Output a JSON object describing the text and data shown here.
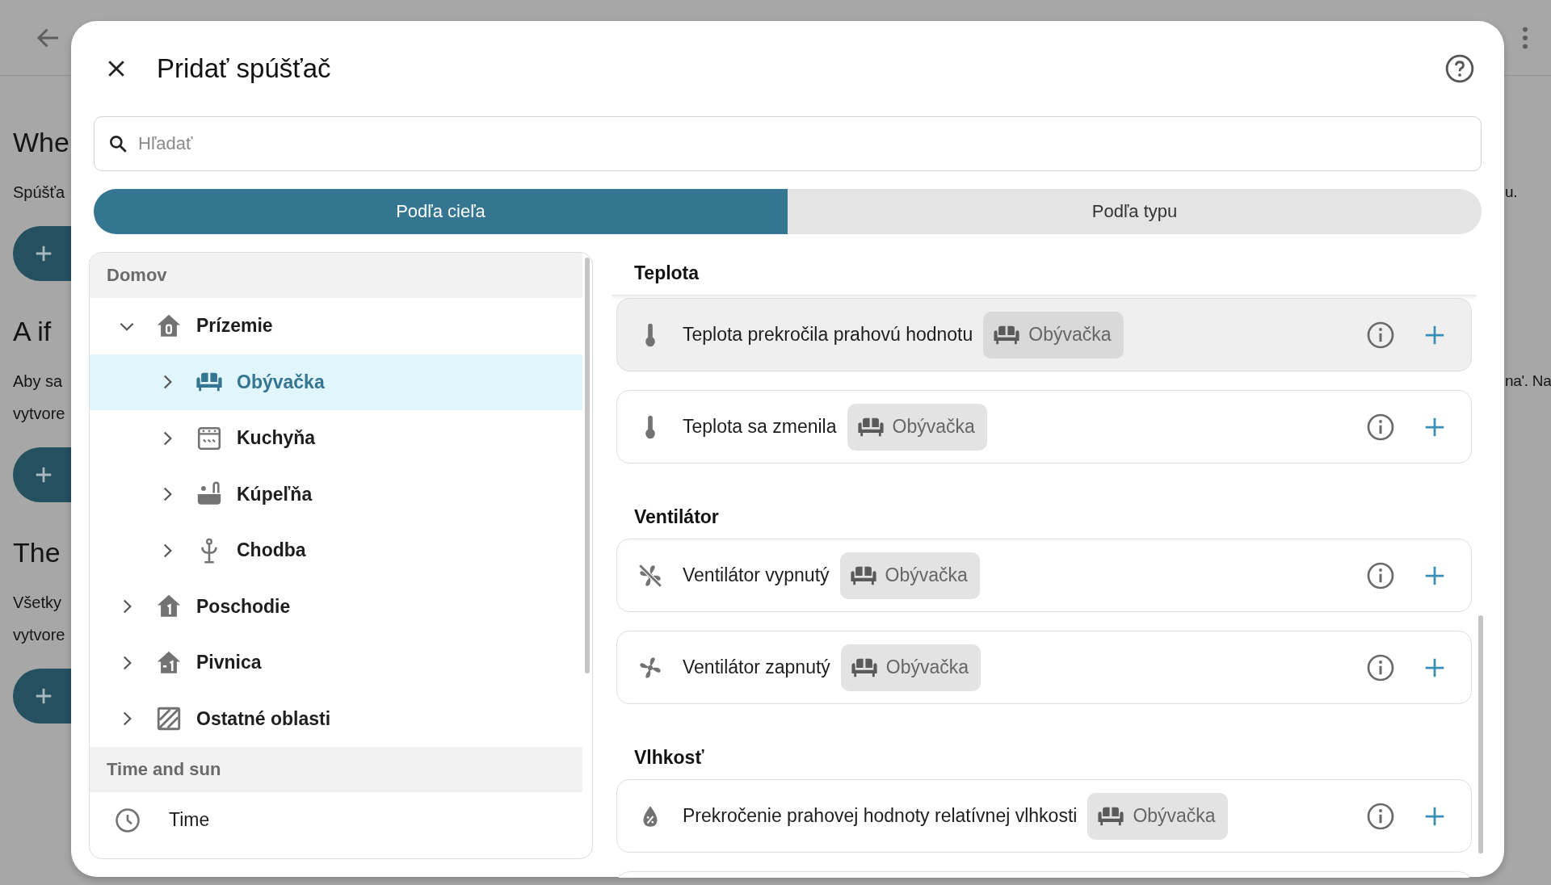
{
  "background": {
    "sections": [
      {
        "heading": "Whe",
        "lines": [
          "Spúšťa"
        ],
        "right_lines": [
          "u."
        ]
      },
      {
        "heading": "A if",
        "lines": [
          "Aby sa",
          "vytvore"
        ],
        "right_lines": [
          "na'. Na"
        ]
      },
      {
        "heading": "The",
        "lines": [
          "Všetky",
          "vytvore"
        ]
      }
    ]
  },
  "dialog": {
    "title": "Pridať spúšťač",
    "search": {
      "placeholder": "Hľadať"
    },
    "tabs": [
      {
        "label": "Podľa cieľa",
        "selected": true
      },
      {
        "label": "Podľa typu",
        "selected": false
      }
    ],
    "tree": [
      {
        "header": "Domov",
        "items": [
          {
            "label": "Prízemie",
            "expanded": true,
            "selected": false,
            "children": [
              {
                "label": "Obývačka",
                "expanded": false,
                "selected": true
              },
              {
                "label": "Kuchyňa",
                "expanded": false,
                "selected": false
              },
              {
                "label": "Kúpeľňa",
                "expanded": false,
                "selected": false
              },
              {
                "label": "Chodba",
                "expanded": false,
                "selected": false
              }
            ]
          },
          {
            "label": "Poschodie",
            "expanded": false,
            "selected": false
          },
          {
            "label": "Pivnica",
            "expanded": false,
            "selected": false
          },
          {
            "label": "Ostatné oblasti",
            "expanded": false,
            "selected": false
          }
        ]
      },
      {
        "header": "Time and sun",
        "items": [
          {
            "label": "Time",
            "selected": false
          }
        ]
      }
    ],
    "triggers": [
      {
        "title": "Teplota",
        "items": [
          {
            "label": "Teplota prekročila prahovú hodnotu",
            "area": "Obývačka",
            "highlighted": true
          },
          {
            "label": "Teplota sa zmenila",
            "area": "Obývačka",
            "highlighted": false
          }
        ]
      },
      {
        "title": "Ventilátor",
        "items": [
          {
            "label": "Ventilátor vypnutý",
            "area": "Obývačka",
            "highlighted": false
          },
          {
            "label": "Ventilátor zapnutý",
            "area": "Obývačka",
            "highlighted": false
          }
        ]
      },
      {
        "title": "Vlhkosť",
        "items": [
          {
            "label": "Prekročenie prahovej hodnoty relatívnej vlhkosti",
            "area": "Obývačka",
            "highlighted": false
          }
        ]
      }
    ]
  }
}
